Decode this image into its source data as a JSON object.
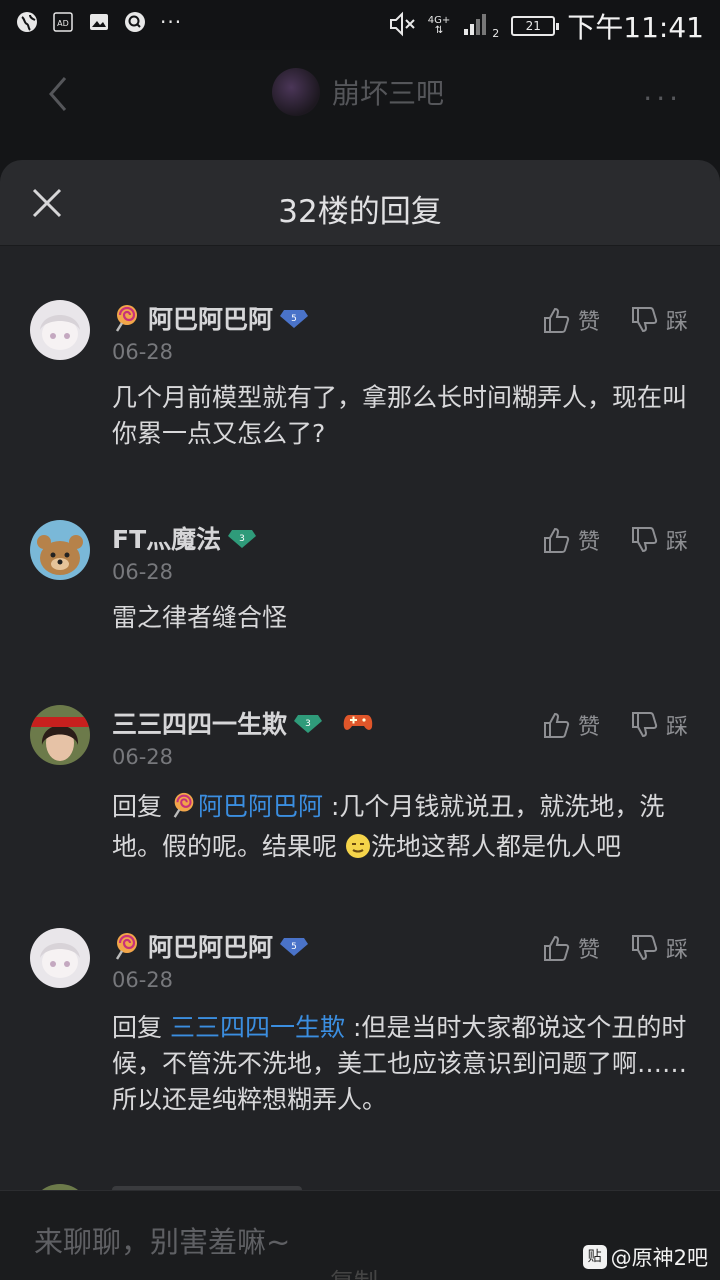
{
  "status_bar": {
    "time": "下午11:41",
    "battery": "21",
    "network": "4G+",
    "sim": "2",
    "dots": "···"
  },
  "background_nav": {
    "forum_name": "崩坏三吧",
    "more": "···"
  },
  "sheet": {
    "title": "32楼的回复"
  },
  "actions": {
    "like": "赞",
    "dislike": "踩"
  },
  "replies": [
    {
      "user": "阿巴阿巴阿",
      "level": "5",
      "date": "06-28",
      "text": "几个月前模型就有了，拿那么长时间糊弄人，现在叫你累一点又怎么了?"
    },
    {
      "user": "FT灬魔法",
      "level": "3",
      "date": "06-28",
      "text": "雷之律者缝合怪"
    },
    {
      "user": "三三四四一生欺",
      "level": "3",
      "date": "06-28",
      "reply_prefix": "回复",
      "reply_to": "阿巴阿巴阿",
      "text_a": ":几个月钱就说丑，就洗地，洗地。假的呢。结果呢",
      "text_b": "洗地这帮人都是仇人吧"
    },
    {
      "user": "阿巴阿巴阿",
      "level": "5",
      "date": "06-28",
      "reply_prefix": "回复",
      "reply_to": "三三四四一生欺",
      "text": ":但是当时大家都说这个丑的时候，不管洗不洗地，美工也应该意识到问题了啊……所以还是纯粹想糊弄人。"
    }
  ],
  "input": {
    "placeholder": "来聊聊，别害羞嘛~"
  },
  "copy_hint": "复制",
  "watermark": {
    "logo": "贴",
    "text": "@原神2吧"
  },
  "colors": {
    "background": "#222326",
    "mention": "#3b8ee0",
    "level5": "#4a73c9",
    "level3": "#2f9b7a"
  }
}
